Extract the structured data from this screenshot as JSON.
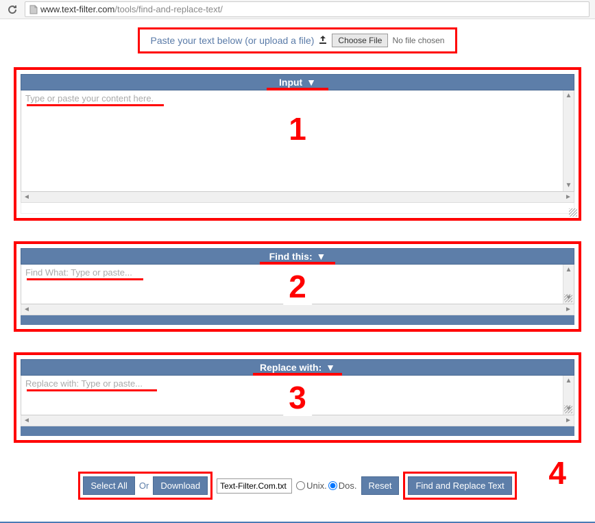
{
  "browser": {
    "url_host": "www.text-filter.com",
    "url_path": "/tools/find-and-replace-text/"
  },
  "upload": {
    "prompt": "Paste your text below (or upload a file)",
    "choose_file": "Choose File",
    "no_file": "No file chosen"
  },
  "sections": {
    "input": {
      "title": "Input",
      "arrow": "▼",
      "placeholder": "Type or paste your content here."
    },
    "find": {
      "title": "Find this:",
      "arrow": "▼",
      "placeholder": "Find What: Type or paste..."
    },
    "replace": {
      "title": "Replace with:",
      "arrow": "▼",
      "placeholder": "Replace with: Type or paste..."
    }
  },
  "controls": {
    "select_all": "Select All",
    "or": "Or",
    "download": "Download",
    "filename": "Text-Filter.Com.txt",
    "unix": "Unix.",
    "dos": "Dos.",
    "reset": "Reset",
    "action": "Find and Replace Text"
  },
  "annotations": {
    "n1": "1",
    "n2": "2",
    "n3": "3",
    "n4": "4"
  }
}
